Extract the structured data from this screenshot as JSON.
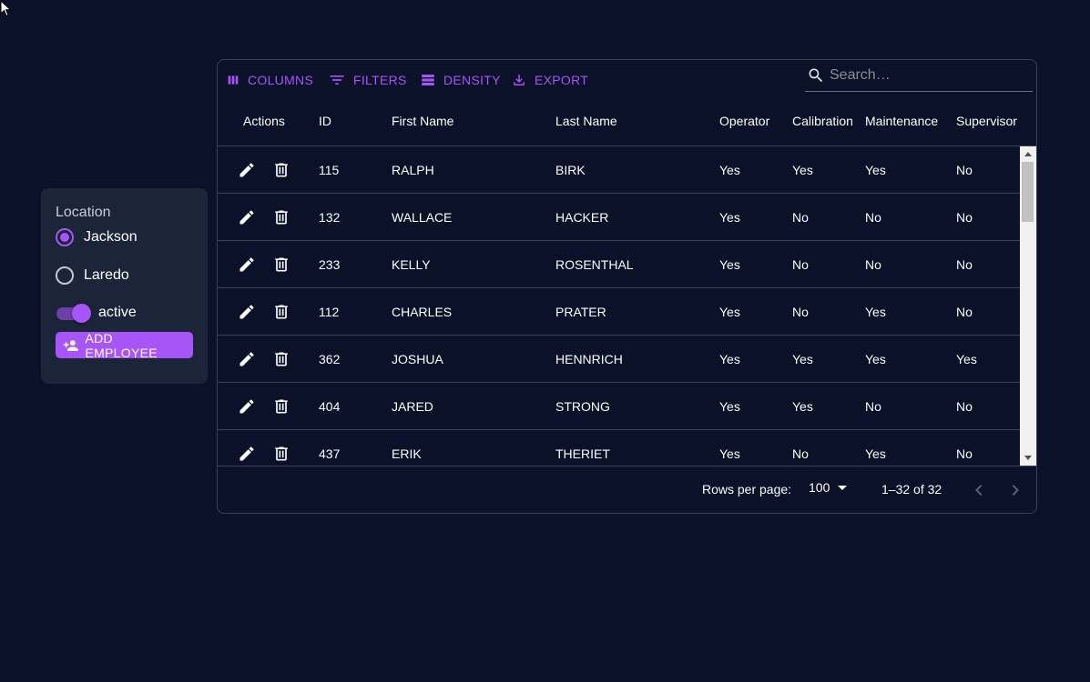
{
  "sidebar": {
    "location_label": "Location",
    "locations": [
      {
        "label": "Jackson",
        "checked": true
      },
      {
        "label": "Laredo",
        "checked": false
      }
    ],
    "active_label": "active",
    "active_on": true,
    "add_employee_label": "ADD EMPLOYEE"
  },
  "toolbar": {
    "columns_label": "COLUMNS",
    "filters_label": "FILTERS",
    "density_label": "DENSITY",
    "export_label": "EXPORT",
    "search_placeholder": "Search…"
  },
  "table": {
    "columns": [
      "Actions",
      "ID",
      "First Name",
      "Last Name",
      "Operator",
      "Calibration",
      "Maintenance",
      "Supervisor"
    ],
    "rows": [
      [
        "115",
        "RALPH",
        "BIRK",
        "Yes",
        "Yes",
        "Yes",
        "No"
      ],
      [
        "132",
        "WALLACE",
        "HACKER",
        "Yes",
        "No",
        "No",
        "No"
      ],
      [
        "233",
        "KELLY",
        "ROSENTHAL",
        "Yes",
        "No",
        "No",
        "No"
      ],
      [
        "112",
        "CHARLES",
        "PRATER",
        "Yes",
        "No",
        "Yes",
        "No"
      ],
      [
        "362",
        "JOSHUA",
        "HENNRICH",
        "Yes",
        "Yes",
        "Yes",
        "Yes"
      ],
      [
        "404",
        "JARED",
        "STRONG",
        "Yes",
        "Yes",
        "No",
        "No"
      ],
      [
        "437",
        "ERIK",
        "THERIET",
        "Yes",
        "No",
        "Yes",
        "No"
      ]
    ]
  },
  "footer": {
    "rows_per_page_label": "Rows per page:",
    "rows_per_page_value": "100",
    "range_text": "1–32 of 32"
  },
  "colors": {
    "background": "#0a1128",
    "panel": "#1b2438",
    "accent": "#a855f7"
  }
}
